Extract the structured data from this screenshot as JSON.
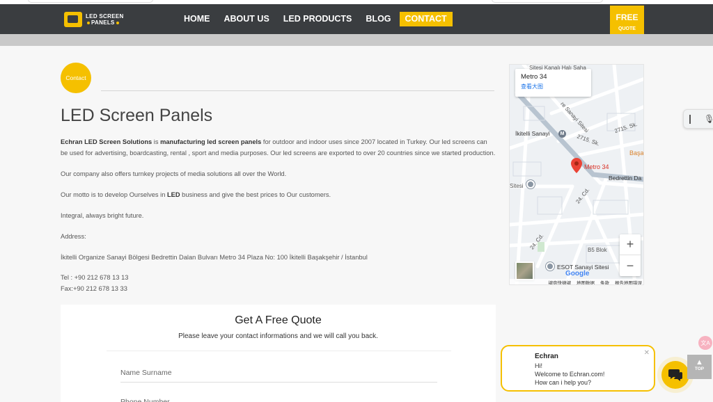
{
  "header": {
    "logo_line1": "LED SCREEN",
    "logo_line2": "PANELS",
    "nav": [
      {
        "label": "HOME"
      },
      {
        "label": "ABOUT US"
      },
      {
        "label": "LED PRODUCTS"
      },
      {
        "label": "BLOG"
      },
      {
        "label": "CONTACT",
        "active": true
      }
    ],
    "free_quote_line1": "FREE",
    "free_quote_line2": "QUOTE"
  },
  "content": {
    "badge": "Contact",
    "title": "LED Screen Panels",
    "intro_bold1": "Echran LED Screen Solutions",
    "intro_text1": " is ",
    "intro_bold2": "manufacturing led screen panels",
    "intro_text2": " for outdoor and indoor uses since 2007 located in Turkey. Our led screens can be used for advertising, boardcasting, rental , sport and media purposes. Our led screens are exported to over 20 countries since we started production.",
    "para2": "Our company also offers turnkey projects of media solutions all over the World.",
    "para3_pre": "Our motto is to develop Ourselves in ",
    "para3_bold": "LED",
    "para3_post": " business and give the best prices to Our customers.",
    "para4": "Integral, always bright future.",
    "address_label": "Address:",
    "address": "İkitelli Organize Sanayi Bölgesi Bedrettin Dalan Bulvarı Metro 34 Plaza No: 100 İkitelli Başakşehir / İstanbul",
    "tel": "Tel : +90 212 678 13 13",
    "fax": "Fax:+90 212 678 13 33"
  },
  "quote_form": {
    "title": "Get A Free Quote",
    "subtitle": "Please leave your contact informations and we will call you back.",
    "name_placeholder": "Name Surname",
    "phone_placeholder": "Phone Number"
  },
  "map": {
    "card_title": "Metro 34",
    "card_link": "查看大图",
    "labels": {
      "top": "Sitesi Kanalı Halı Saha",
      "sanayi_sitesi": "re Sanayi Sitesi",
      "ikitelli": "İkitelli Sanayi",
      "sk2715": "2715. Sk.",
      "sk2715b": "2715. Sk.",
      "basa": "Başa",
      "pin_label": "Metro 34",
      "bedrettin": "Bedrettin Da",
      "cd24": "24. Cd.",
      "cd24b": "24. Cd.",
      "sitesi": "Sitesi",
      "b5": "B5 Blok",
      "esot": "ESOT Sanayi Sitesi"
    },
    "google": "Google",
    "footer": [
      "键盘快捷键",
      "地图数据",
      "条款",
      "报告地图错误"
    ]
  },
  "chat": {
    "name": "Echran",
    "line1": "Hi!",
    "line2": "Welcome to Echran.com!",
    "line3": "How can i help you?"
  },
  "top_button": "TOP",
  "colors": {
    "accent": "#f5c000",
    "nav_bg": "#3a3d40"
  }
}
